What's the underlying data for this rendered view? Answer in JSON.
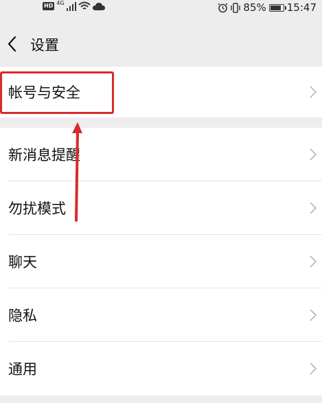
{
  "status_bar": {
    "network_badge": "HD",
    "network_type": "4G",
    "battery_percent": "85%",
    "time": "15:47"
  },
  "header": {
    "title": "设置"
  },
  "settings": {
    "account_security": "帐号与安全",
    "items": [
      {
        "label": "新消息提醒"
      },
      {
        "label": "勿扰模式"
      },
      {
        "label": "聊天"
      },
      {
        "label": "隐私"
      },
      {
        "label": "通用"
      }
    ]
  },
  "colors": {
    "annotation": "#d92a2a",
    "background": "#ededed",
    "row_background": "#ffffff"
  }
}
